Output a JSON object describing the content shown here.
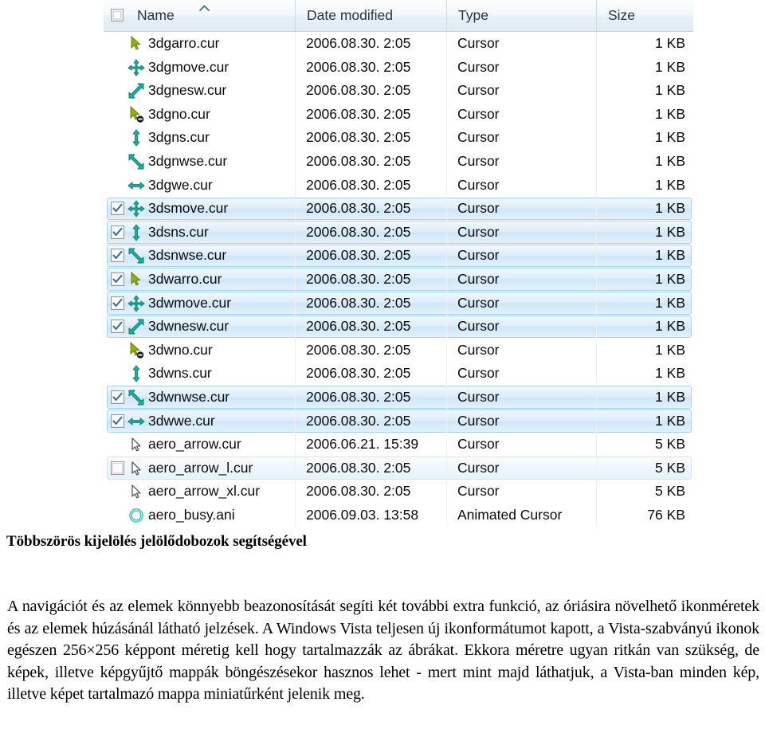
{
  "explorer": {
    "columns": [
      {
        "key": "name",
        "label": "Name",
        "sort": "ascending"
      },
      {
        "key": "date",
        "label": "Date modified"
      },
      {
        "key": "type",
        "label": "Type"
      },
      {
        "key": "size",
        "label": "Size"
      }
    ],
    "select_all_checkbox": {
      "name": "select-all-checkbox",
      "checked": false
    },
    "rows": [
      {
        "name": "3dgarro.cur",
        "date": "2006.08.30. 2:05",
        "type": "Cursor",
        "size": "1 KB",
        "icon": "cursor-arrow",
        "checkbox": "none",
        "state": "normal"
      },
      {
        "name": "3dgmove.cur",
        "date": "2006.08.30. 2:05",
        "type": "Cursor",
        "size": "1 KB",
        "icon": "cursor-move",
        "checkbox": "none",
        "state": "normal"
      },
      {
        "name": "3dgnesw.cur",
        "date": "2006.08.30. 2:05",
        "type": "Cursor",
        "size": "1 KB",
        "icon": "cursor-resize-nesw",
        "checkbox": "none",
        "state": "normal"
      },
      {
        "name": "3dgno.cur",
        "date": "2006.08.30. 2:05",
        "type": "Cursor",
        "size": "1 KB",
        "icon": "cursor-unavailable",
        "checkbox": "none",
        "state": "normal"
      },
      {
        "name": "3dgns.cur",
        "date": "2006.08.30. 2:05",
        "type": "Cursor",
        "size": "1 KB",
        "icon": "cursor-resize-ns",
        "checkbox": "none",
        "state": "normal"
      },
      {
        "name": "3dgnwse.cur",
        "date": "2006.08.30. 2:05",
        "type": "Cursor",
        "size": "1 KB",
        "icon": "cursor-resize-nwse",
        "checkbox": "none",
        "state": "normal"
      },
      {
        "name": "3dgwe.cur",
        "date": "2006.08.30. 2:05",
        "type": "Cursor",
        "size": "1 KB",
        "icon": "cursor-resize-we",
        "checkbox": "none",
        "state": "normal"
      },
      {
        "name": "3dsmove.cur",
        "date": "2006.08.30. 2:05",
        "type": "Cursor",
        "size": "1 KB",
        "icon": "cursor-move",
        "checkbox": "checked",
        "state": "selected"
      },
      {
        "name": "3dsns.cur",
        "date": "2006.08.30. 2:05",
        "type": "Cursor",
        "size": "1 KB",
        "icon": "cursor-resize-ns",
        "checkbox": "checked",
        "state": "selected"
      },
      {
        "name": "3dsnwse.cur",
        "date": "2006.08.30. 2:05",
        "type": "Cursor",
        "size": "1 KB",
        "icon": "cursor-resize-nwse",
        "checkbox": "checked",
        "state": "selected"
      },
      {
        "name": "3dwarro.cur",
        "date": "2006.08.30. 2:05",
        "type": "Cursor",
        "size": "1 KB",
        "icon": "cursor-arrow",
        "checkbox": "checked",
        "state": "selected"
      },
      {
        "name": "3dwmove.cur",
        "date": "2006.08.30. 2:05",
        "type": "Cursor",
        "size": "1 KB",
        "icon": "cursor-move",
        "checkbox": "checked",
        "state": "selected"
      },
      {
        "name": "3dwnesw.cur",
        "date": "2006.08.30. 2:05",
        "type": "Cursor",
        "size": "1 KB",
        "icon": "cursor-resize-nesw",
        "checkbox": "checked",
        "state": "selected"
      },
      {
        "name": "3dwno.cur",
        "date": "2006.08.30. 2:05",
        "type": "Cursor",
        "size": "1 KB",
        "icon": "cursor-unavailable",
        "checkbox": "none",
        "state": "normal"
      },
      {
        "name": "3dwns.cur",
        "date": "2006.08.30. 2:05",
        "type": "Cursor",
        "size": "1 KB",
        "icon": "cursor-resize-ns",
        "checkbox": "none",
        "state": "normal"
      },
      {
        "name": "3dwnwse.cur",
        "date": "2006.08.30. 2:05",
        "type": "Cursor",
        "size": "1 KB",
        "icon": "cursor-resize-nwse",
        "checkbox": "checked",
        "state": "selected"
      },
      {
        "name": "3dwwe.cur",
        "date": "2006.08.30. 2:05",
        "type": "Cursor",
        "size": "1 KB",
        "icon": "cursor-resize-we",
        "checkbox": "checked",
        "state": "selected"
      },
      {
        "name": "aero_arrow.cur",
        "date": "2006.06.21. 15:39",
        "type": "Cursor",
        "size": "5 KB",
        "icon": "cursor-aero-arrow",
        "checkbox": "none",
        "state": "normal"
      },
      {
        "name": "aero_arrow_l.cur",
        "date": "2006.08.30. 2:05",
        "type": "Cursor",
        "size": "5 KB",
        "icon": "cursor-aero-arrow",
        "checkbox": "empty",
        "state": "hover"
      },
      {
        "name": "aero_arrow_xl.cur",
        "date": "2006.08.30. 2:05",
        "type": "Cursor",
        "size": "5 KB",
        "icon": "cursor-aero-arrow",
        "checkbox": "none",
        "state": "normal"
      },
      {
        "name": "aero_busy.ani",
        "date": "2006.09.03. 13:58",
        "type": "Animated Cursor",
        "size": "76 KB",
        "icon": "cursor-busy-ring",
        "checkbox": "none",
        "state": "normal"
      }
    ]
  },
  "caption": "Többszörös kijelölés jelölődobozok segítségével",
  "body": "A navigációt és az elemek könnyebb beazonosítását segíti két további extra funkció, az óriásira növelhető ikonméretek és az elemek húzásánál látható jelzések. A Windows Vista teljesen új ikonformátumot kapott, a Vista-szabványú ikonok egészen 256×256 képpont méretig kell hogy tartalmazzák az ábrákat. Ekkora méretre ugyan ritkán van szükség, de képek, illetve képgyűjtő mappák böngészésekor hasznos lehet - mert mint majd láthatjuk, a Vista-ban minden kép, illetve képet tartalmazó mappa miniatűrként jelenik meg.",
  "colors": {
    "selection_fill": "#cfe6f8",
    "selection_border": "#a6d2f0",
    "header_gradient_top": "#fdfefe",
    "header_gradient_bottom": "#dfeaf4",
    "checkmark": "#3a6ea5",
    "cursor_icon_green": "#a8b400",
    "cursor_icon_teal": "#1fb8a8"
  }
}
